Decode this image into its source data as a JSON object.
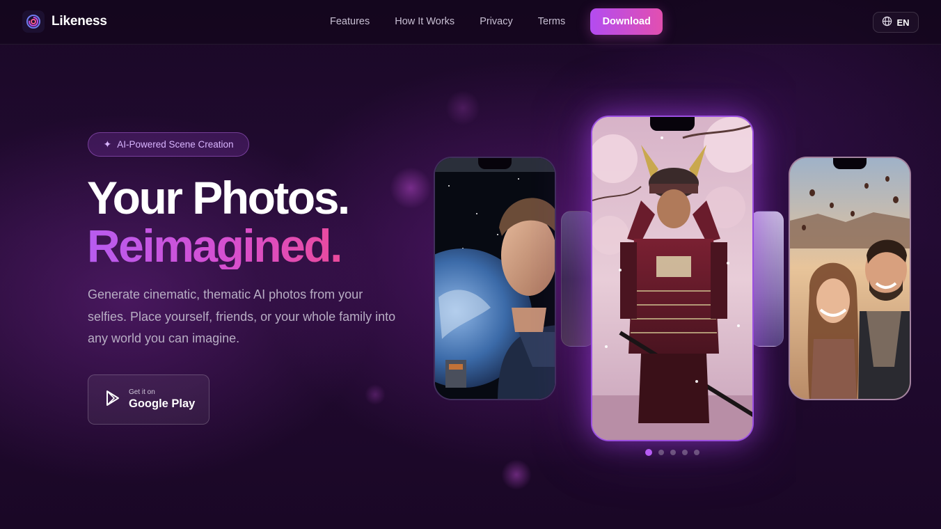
{
  "app": {
    "name": "Likeness"
  },
  "nav": {
    "items": [
      "Features",
      "How It Works",
      "Privacy",
      "Terms"
    ],
    "download_label": "Download",
    "language": "EN"
  },
  "hero": {
    "badge": "AI-Powered Scene Creation",
    "headline_line1": "Your Photos.",
    "headline_line2": "Reimagined.",
    "description": "Generate cinematic, thematic AI photos from your selfies. Place yourself, friends, or your whole family into any world you can imagine.",
    "store_small": "Get it on",
    "store_big": "Google Play"
  },
  "carousel": {
    "slides": [
      "astronaut-in-space",
      "samurai-under-cherry-blossoms",
      "couple-with-hot-air-balloons"
    ],
    "active_index": 0,
    "count": 5
  },
  "colors": {
    "accent_purple": "#b34cf0",
    "accent_pink": "#e24fb0",
    "background": "#12061c"
  }
}
